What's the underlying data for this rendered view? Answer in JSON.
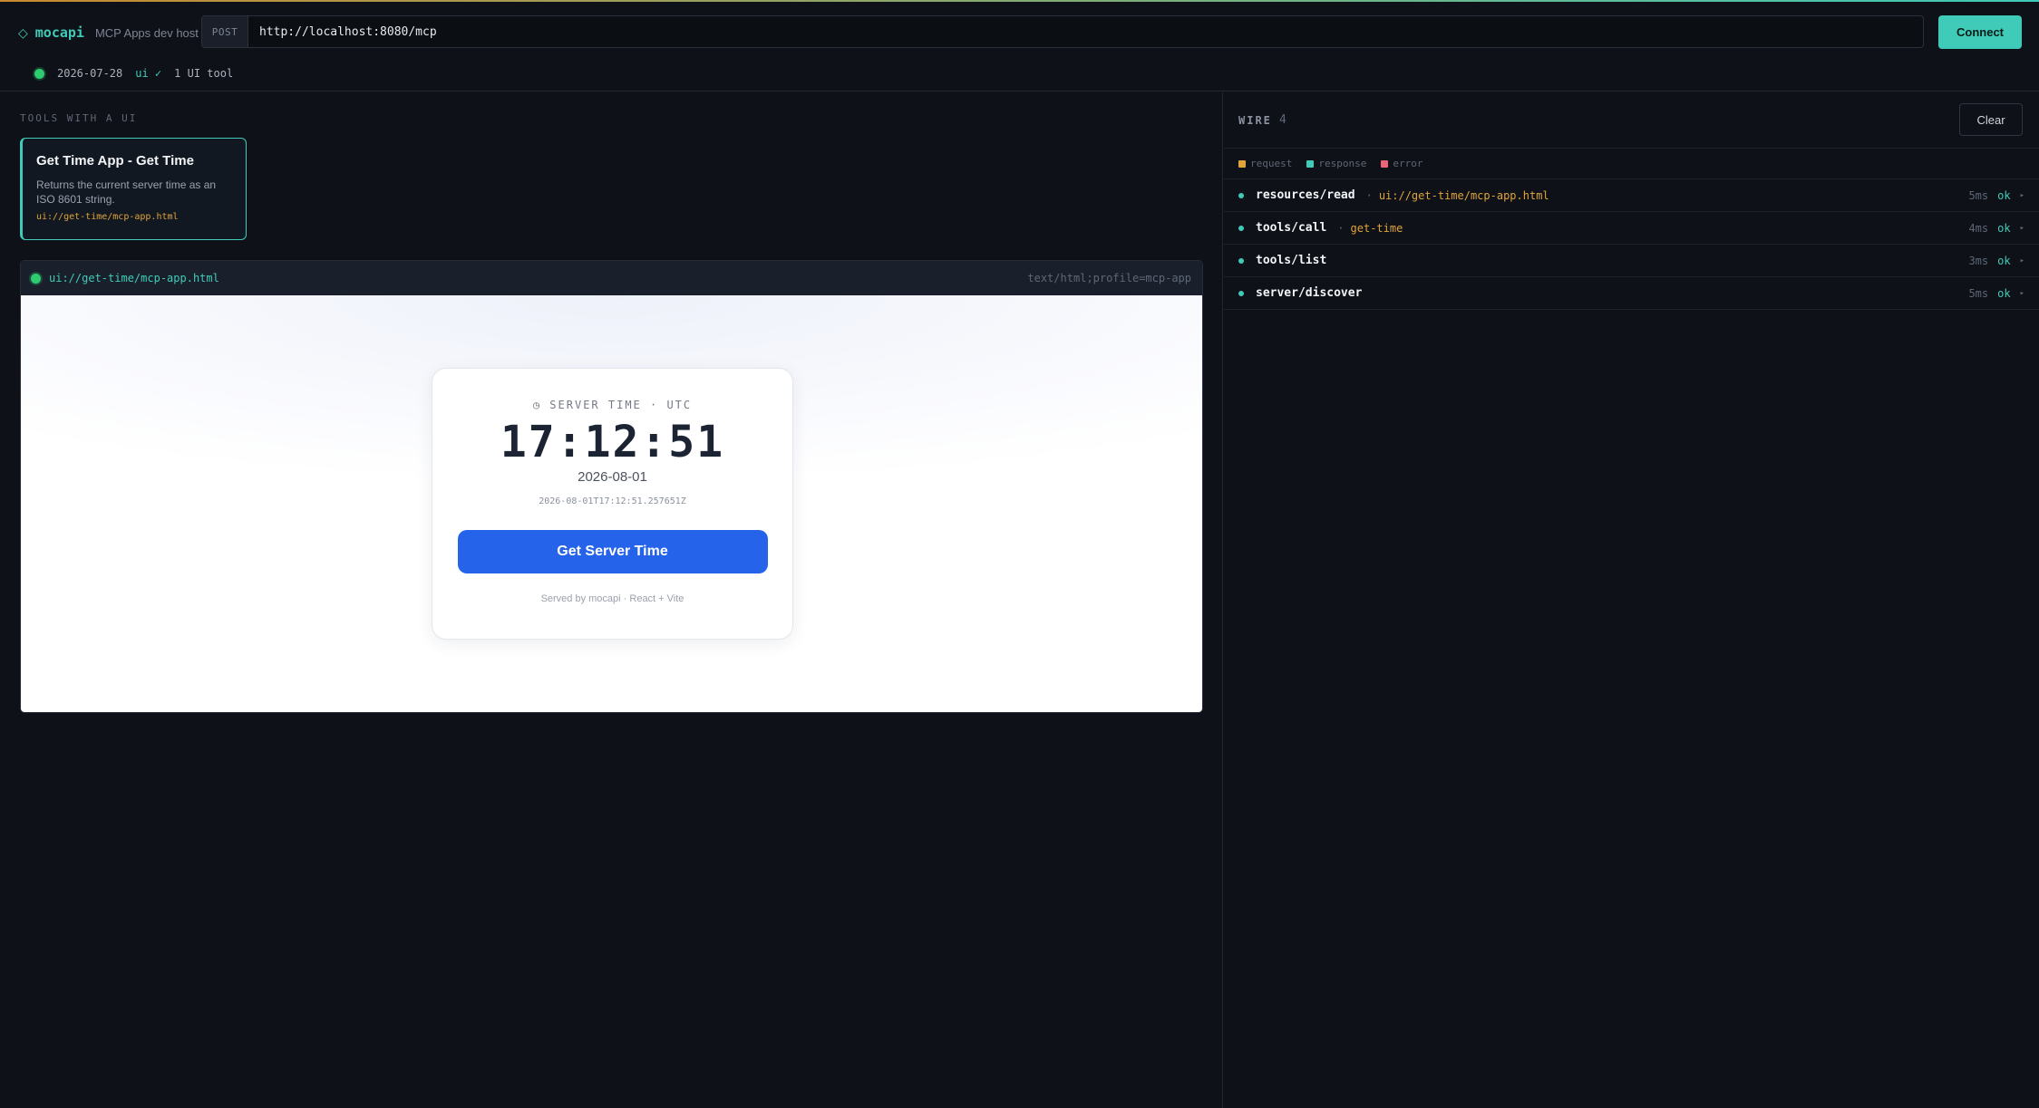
{
  "app": {
    "brand_icon": "◇",
    "name": "mocapi",
    "subtitle": "MCP Apps dev host"
  },
  "request": {
    "method": "POST",
    "url": "http://localhost:8080/mcp",
    "connect_label": "Connect"
  },
  "status": {
    "date": "2026-07-28",
    "ui_badge": "ui ✓",
    "tool_count": "1 UI tool"
  },
  "tools": {
    "section_label": "TOOLS WITH A UI",
    "items": [
      {
        "title": "Get Time App - Get Time",
        "description": "Returns the current server time as an ISO 8601 string.",
        "uri": "ui://get-time/mcp-app.html"
      }
    ]
  },
  "preview": {
    "uri": "ui://get-time/mcp-app.html",
    "mime": "text/html;profile=mcp-app",
    "app": {
      "label": "◷ SERVER TIME · UTC",
      "time": "17:12:51",
      "date": "2026-08-01",
      "iso": "2026-08-01T17:12:51.257651Z",
      "button_label": "Get Server Time",
      "footer": "Served by mocapi · React + Vite"
    }
  },
  "wire": {
    "title": "WIRE",
    "count": "4",
    "clear_label": "Clear",
    "legend": [
      {
        "label": "request",
        "color": "#e0a43a"
      },
      {
        "label": "response",
        "color": "#3fcbb8"
      },
      {
        "label": "error",
        "color": "#f06478"
      }
    ],
    "rows": [
      {
        "method": "resources/read",
        "sep": "·",
        "arg": "ui://get-time/mcp-app.html",
        "ms": "5ms",
        "status": "ok",
        "caret": "▸"
      },
      {
        "method": "tools/call",
        "sep": "·",
        "arg": "get-time",
        "ms": "4ms",
        "status": "ok",
        "caret": "▸"
      },
      {
        "method": "tools/list",
        "sep": "",
        "arg": "",
        "ms": "3ms",
        "status": "ok",
        "caret": "▸"
      },
      {
        "method": "server/discover",
        "sep": "",
        "arg": "",
        "ms": "5ms",
        "status": "ok",
        "caret": "▸"
      }
    ]
  }
}
